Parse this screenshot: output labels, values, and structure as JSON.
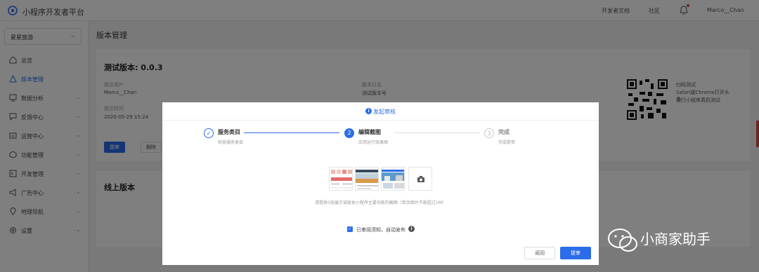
{
  "topbar": {
    "brand": "小程序开发者平台",
    "links": [
      "开发者文档",
      "社区"
    ],
    "user": "Marco__Chan"
  },
  "sidebar": {
    "project": "星星旅游",
    "items": [
      {
        "label": "总览",
        "icon": "home-icon",
        "expandable": false
      },
      {
        "label": "版本管理",
        "icon": "warning-icon",
        "expandable": false,
        "active": true
      },
      {
        "label": "数据分析",
        "icon": "chart-icon",
        "expandable": true
      },
      {
        "label": "反馈中心",
        "icon": "feedback-icon",
        "expandable": true
      },
      {
        "label": "运营中心",
        "icon": "operation-icon",
        "expandable": true
      },
      {
        "label": "功能管理",
        "icon": "function-icon",
        "expandable": true
      },
      {
        "label": "开发管理",
        "icon": "dev-icon",
        "expandable": true
      },
      {
        "label": "广告中心",
        "icon": "megaphone-icon",
        "expandable": true
      },
      {
        "label": "地理导航",
        "icon": "location-icon",
        "expandable": true
      },
      {
        "label": "设置",
        "icon": "gear-icon",
        "expandable": true
      }
    ]
  },
  "main": {
    "title": "版本管理",
    "test_card": {
      "title": "测试版本: 0.0.3",
      "submitter_label": "提交用户",
      "submitter": "Marco__Chan",
      "time_label": "提交时间",
      "time": "2020-05-29 15:24",
      "note_label": "版本日志",
      "note": "测试版本号",
      "submit_btn": "提审",
      "delete_btn": "删除"
    },
    "qr_text": [
      "扫码测试",
      "Safari或Chrome打开头条",
      "进行小程序真机测试"
    ],
    "online_card": {
      "title": "线上版本"
    }
  },
  "modal": {
    "title": "发起审核",
    "steps": [
      {
        "num": "✓",
        "title": "服务类目",
        "sub": "检查服务类目"
      },
      {
        "num": "2",
        "title": "编辑截图",
        "sub": "应用运行效果图"
      },
      {
        "num": "3",
        "title": "完成",
        "sub": "完成提审"
      }
    ],
    "hint": "请提供3张展示该版本小程序主要功能的截图（单张图片不能超过1M）",
    "agree": "已审阅须知，自动发布",
    "cancel": "返回",
    "submit": "提审"
  },
  "watermark": "小商家助手",
  "colors": {
    "accent": "#2b6de8",
    "overlay": "rgba(0,0,0,0.5)"
  }
}
